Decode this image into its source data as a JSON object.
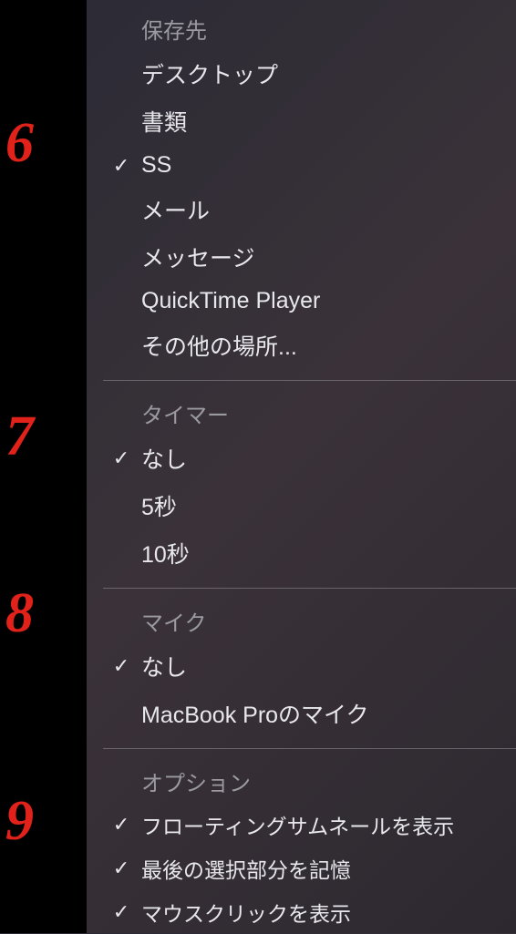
{
  "annotations": {
    "a6": "6",
    "a7": "7",
    "a8": "8",
    "a9": "9"
  },
  "sections": {
    "saveTo": {
      "header": "保存先",
      "items": [
        {
          "label": "デスクトップ",
          "checked": false
        },
        {
          "label": "書類",
          "checked": false
        },
        {
          "label": "SS",
          "checked": true
        },
        {
          "label": "メール",
          "checked": false
        },
        {
          "label": "メッセージ",
          "checked": false
        },
        {
          "label": "QuickTime Player",
          "checked": false
        },
        {
          "label": "その他の場所...",
          "checked": false
        }
      ]
    },
    "timer": {
      "header": "タイマー",
      "items": [
        {
          "label": "なし",
          "checked": true
        },
        {
          "label": "5秒",
          "checked": false
        },
        {
          "label": "10秒",
          "checked": false
        }
      ]
    },
    "mic": {
      "header": "マイク",
      "items": [
        {
          "label": "なし",
          "checked": true
        },
        {
          "label": "MacBook Proのマイク",
          "checked": false
        }
      ]
    },
    "options": {
      "header": "オプション",
      "items": [
        {
          "label": "フローティングサムネールを表示",
          "checked": true
        },
        {
          "label": "最後の選択部分を記憶",
          "checked": true
        },
        {
          "label": "マウスクリックを表示",
          "checked": true
        }
      ]
    }
  },
  "checkGlyph": "✓"
}
